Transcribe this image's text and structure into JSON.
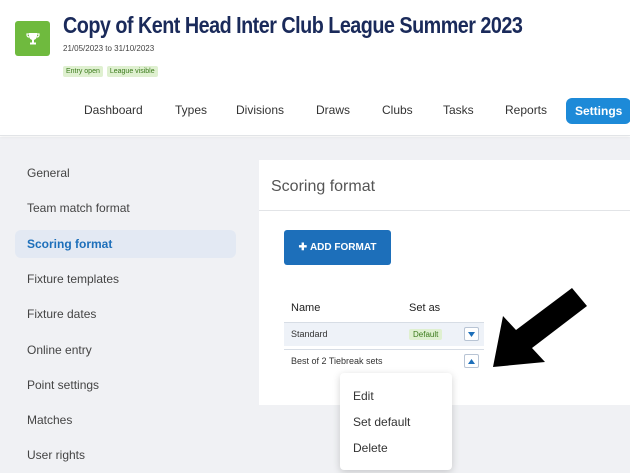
{
  "league": {
    "title": "Copy of Kent Head Inter Club League Summer 2023",
    "dates": "21/05/2023 to 31/10/2023",
    "badges": [
      "Entry open",
      "League visible"
    ]
  },
  "nav": {
    "items": [
      "Dashboard",
      "Types",
      "Divisions",
      "Draws",
      "Clubs",
      "Tasks",
      "Reports",
      "Settings"
    ],
    "active": "Settings"
  },
  "sidebar": {
    "items": [
      "General",
      "Team match format",
      "Scoring format",
      "Fixture templates",
      "Fixture dates",
      "Online entry",
      "Point settings",
      "Matches",
      "User rights"
    ],
    "active": "Scoring format"
  },
  "panel": {
    "title": "Scoring format",
    "add_button": "ADD FORMAT",
    "columns": [
      "Name",
      "Set as"
    ],
    "rows": [
      {
        "name": "Standard",
        "set_as": "Default"
      },
      {
        "name": "Best of 2 Tiebreak sets",
        "set_as": ""
      }
    ]
  },
  "dropdown": {
    "items": [
      "Edit",
      "Set default",
      "Delete"
    ]
  },
  "colors": {
    "primary": "#1d6fba",
    "accent_green": "#6fba3e",
    "title_navy": "#1a2a5a",
    "badge_bg": "#dff0d0"
  }
}
